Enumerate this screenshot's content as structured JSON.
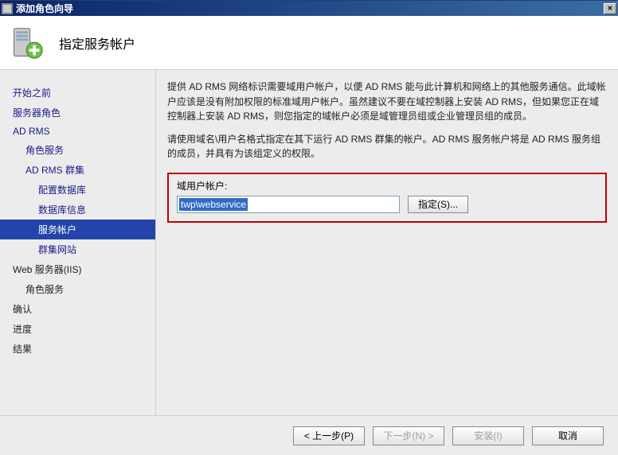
{
  "window": {
    "title": "添加角色向导"
  },
  "header": {
    "title": "指定服务帐户"
  },
  "sidebar": {
    "items": [
      {
        "label": "开始之前",
        "indent": 0,
        "plain": false,
        "selected": false
      },
      {
        "label": "服务器角色",
        "indent": 0,
        "plain": false,
        "selected": false
      },
      {
        "label": "AD RMS",
        "indent": 0,
        "plain": false,
        "selected": false
      },
      {
        "label": "角色服务",
        "indent": 1,
        "plain": false,
        "selected": false
      },
      {
        "label": "AD RMS 群集",
        "indent": 1,
        "plain": false,
        "selected": false
      },
      {
        "label": "配置数据库",
        "indent": 2,
        "plain": false,
        "selected": false
      },
      {
        "label": "数据库信息",
        "indent": 2,
        "plain": false,
        "selected": false
      },
      {
        "label": "服务帐户",
        "indent": 2,
        "plain": false,
        "selected": true
      },
      {
        "label": "群集网站",
        "indent": 2,
        "plain": false,
        "selected": false
      },
      {
        "label": "Web 服务器(IIS)",
        "indent": 0,
        "plain": true,
        "selected": false
      },
      {
        "label": "角色服务",
        "indent": 1,
        "plain": true,
        "selected": false
      },
      {
        "label": "确认",
        "indent": 0,
        "plain": true,
        "selected": false
      },
      {
        "label": "进度",
        "indent": 0,
        "plain": true,
        "selected": false
      },
      {
        "label": "结果",
        "indent": 0,
        "plain": true,
        "selected": false
      }
    ],
    "selected_label": "服务帐户"
  },
  "content": {
    "para1": "提供 AD RMS 网络标识需要域用户帐户，以便 AD RMS 能与此计算机和网络上的其他服务通信。此域帐户应该是没有附加权限的标准域用户帐户。虽然建议不要在域控制器上安装 AD RMS，但如果您正在域控制器上安装 AD RMS，则您指定的域帐户必须是域管理员组或企业管理员组的成员。",
    "para2": "请使用域名\\用户名格式指定在其下运行 AD RMS 群集的帐户。AD RMS 服务帐户将是 AD RMS 服务组的成员，并具有为该组定义的权限。",
    "field_label": "域用户帐户:",
    "field_value": "twp\\webservice",
    "specify_button": "指定(S)..."
  },
  "footer": {
    "prev": "< 上一步(P)",
    "next": "下一步(N) >",
    "install": "安装(I)",
    "cancel": "取消"
  }
}
